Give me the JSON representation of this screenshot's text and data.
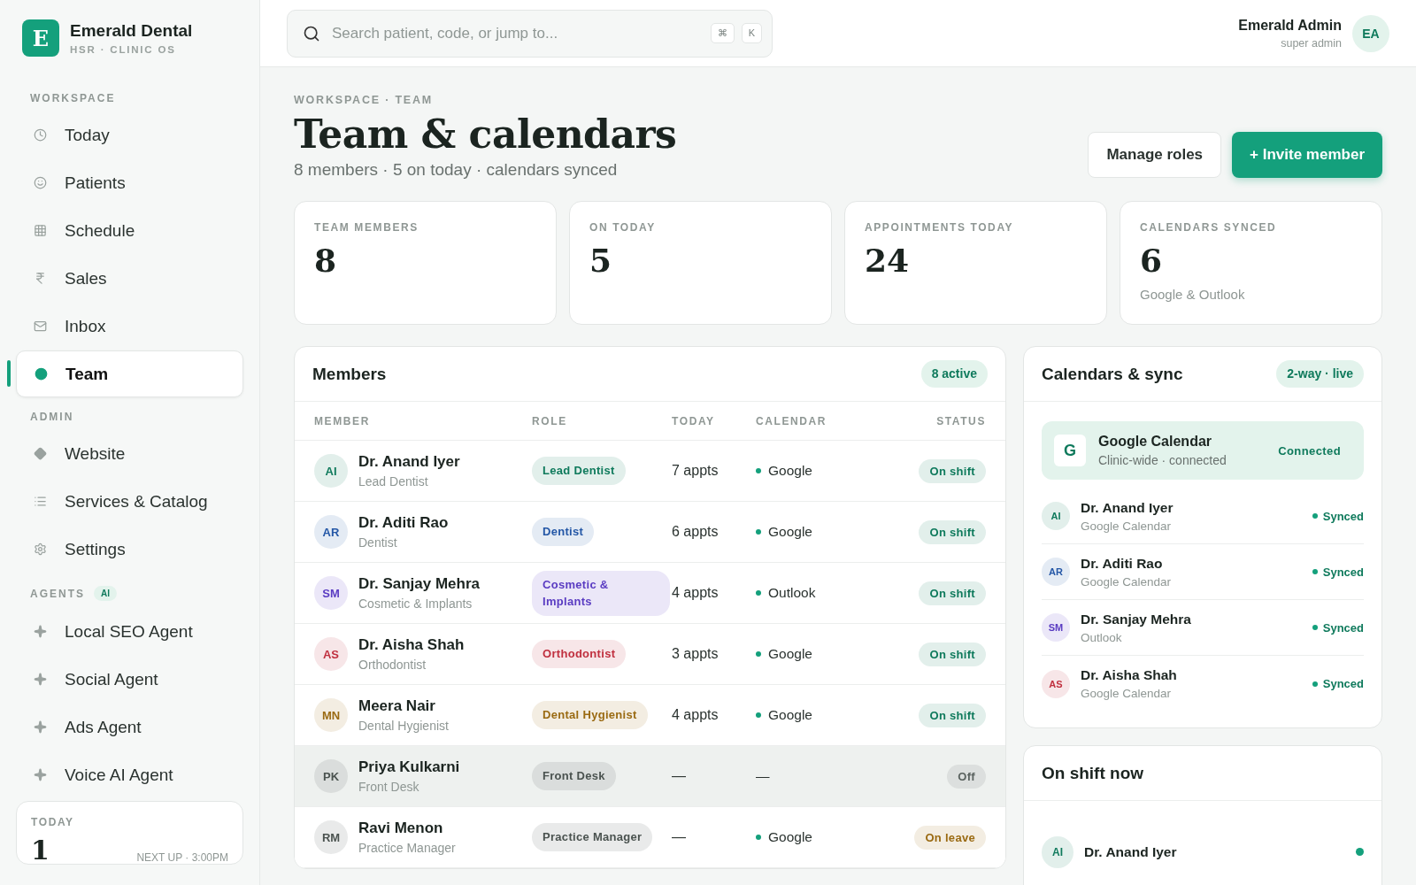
{
  "brand": {
    "logo": "E",
    "name": "Emerald Dental",
    "subtitle": "HSR · CLINIC OS"
  },
  "sidebar": {
    "sections": [
      {
        "title": "WORKSPACE",
        "items": [
          {
            "label": "Today",
            "selected": false
          },
          {
            "label": "Patients",
            "selected": false
          },
          {
            "label": "Schedule",
            "selected": false
          },
          {
            "label": "Sales",
            "selected": false
          },
          {
            "label": "Inbox",
            "selected": false
          },
          {
            "label": "Team",
            "selected": true
          }
        ]
      },
      {
        "title": "ADMIN",
        "items": [
          {
            "label": "Website",
            "selected": false
          },
          {
            "label": "Services & Catalog",
            "selected": false
          },
          {
            "label": "Settings",
            "selected": false
          }
        ]
      },
      {
        "title": "AGENTS",
        "badge": "AI",
        "items": [
          {
            "label": "Local SEO Agent",
            "selected": false
          },
          {
            "label": "Social Agent",
            "selected": false
          },
          {
            "label": "Ads Agent",
            "selected": false
          },
          {
            "label": "Voice AI Agent",
            "selected": false
          }
        ]
      }
    ],
    "today_card": {
      "label": "TODAY",
      "value": "1",
      "next": "NEXT UP · 3:00PM"
    }
  },
  "search": {
    "placeholder": "Search patient, code, or jump to...",
    "keys": [
      "⌘",
      "K"
    ]
  },
  "user": {
    "name": "Emerald Admin",
    "role": "super admin",
    "initials": "EA"
  },
  "header": {
    "breadcrumb": "WORKSPACE · TEAM",
    "title": "Team & calendars",
    "subtitle": "8 members · 5 on today · calendars synced",
    "buttons": [
      {
        "label": "Manage roles",
        "kind": "secondary"
      },
      {
        "label": "+ Invite member",
        "kind": "primary"
      }
    ]
  },
  "stats": [
    {
      "label": "TEAM MEMBERS",
      "value": "8"
    },
    {
      "label": "ON TODAY",
      "value": "5"
    },
    {
      "label": "APPOINTMENTS TODAY",
      "value": "24"
    },
    {
      "label": "CALENDARS SYNCED",
      "value": "6",
      "note": "Google & Outlook"
    }
  ],
  "members": {
    "title": "Members",
    "badge": "8 active",
    "columns": [
      "MEMBER",
      "ROLE",
      "TODAY",
      "CALENDAR",
      "STATUS"
    ],
    "rows": [
      {
        "initials": "AI",
        "name": "Dr. Anand Iyer",
        "subtitle": "Lead Dentist",
        "role": "Lead Dentist",
        "color": "#0f7a5c",
        "today": "7 appts",
        "calendar": "Google",
        "connected": true,
        "status": {
          "label": "On shift",
          "color": "#0f7a5c"
        },
        "selected": false
      },
      {
        "initials": "AR",
        "name": "Dr. Aditi Rao",
        "subtitle": "Dentist",
        "role": "Dentist",
        "color": "#2457a6",
        "today": "6 appts",
        "calendar": "Google",
        "connected": true,
        "status": {
          "label": "On shift",
          "color": "#0f7a5c"
        },
        "selected": false
      },
      {
        "initials": "SM",
        "name": "Dr. Sanjay Mehra",
        "subtitle": "Cosmetic & Implants",
        "role": "Cosmetic & Implants",
        "color": "#5a3cc2",
        "today": "4 appts",
        "calendar": "Outlook",
        "connected": true,
        "status": {
          "label": "On shift",
          "color": "#0f7a5c"
        },
        "selected": false
      },
      {
        "initials": "AS",
        "name": "Dr. Aisha Shah",
        "subtitle": "Orthodontist",
        "role": "Orthodontist",
        "color": "#c0303f",
        "today": "3 appts",
        "calendar": "Google",
        "connected": true,
        "status": {
          "label": "On shift",
          "color": "#0f7a5c"
        },
        "selected": false
      },
      {
        "initials": "MN",
        "name": "Meera Nair",
        "subtitle": "Dental Hygienist",
        "role": "Dental Hygienist",
        "color": "#9a6a12",
        "today": "4 appts",
        "calendar": "Google",
        "connected": true,
        "status": {
          "label": "On shift",
          "color": "#0f7a5c"
        },
        "selected": false
      },
      {
        "initials": "PK",
        "name": "Priya Kulkarni",
        "subtitle": "Front Desk",
        "role": "Front Desk",
        "color": "#4a524f",
        "today": "—",
        "calendar": "—",
        "connected": false,
        "status": {
          "label": "Off",
          "color": "#5b6360"
        },
        "selected": true
      },
      {
        "initials": "RM",
        "name": "Ravi Menon",
        "subtitle": "Practice Manager",
        "role": "Practice Manager",
        "color": "#4a524f",
        "today": "—",
        "calendar": "Google",
        "connected": true,
        "status": {
          "label": "On leave",
          "color": "#9a6a12"
        },
        "selected": false
      }
    ]
  },
  "calendars": {
    "title": "Calendars & sync",
    "badge": "2-way · live",
    "provider": {
      "logo": "G",
      "name": "Google Calendar",
      "detail": "Clinic-wide · connected",
      "status": "Connected"
    },
    "rows": [
      {
        "initials": "AI",
        "color": "#0f7a5c",
        "name": "Dr. Anand Iyer",
        "source": "Google Calendar",
        "status": "Synced"
      },
      {
        "initials": "AR",
        "color": "#2457a6",
        "name": "Dr. Aditi Rao",
        "source": "Google Calendar",
        "status": "Synced"
      },
      {
        "initials": "SM",
        "color": "#5a3cc2",
        "name": "Dr. Sanjay Mehra",
        "source": "Outlook",
        "status": "Synced"
      },
      {
        "initials": "AS",
        "color": "#c0303f",
        "name": "Dr. Aisha Shah",
        "source": "Google Calendar",
        "status": "Synced"
      }
    ]
  },
  "on_shift": {
    "title": "On shift now",
    "rows": [
      {
        "initials": "AI",
        "color": "#0f7a5c",
        "name": "Dr. Anand Iyer",
        "online": true
      }
    ]
  }
}
